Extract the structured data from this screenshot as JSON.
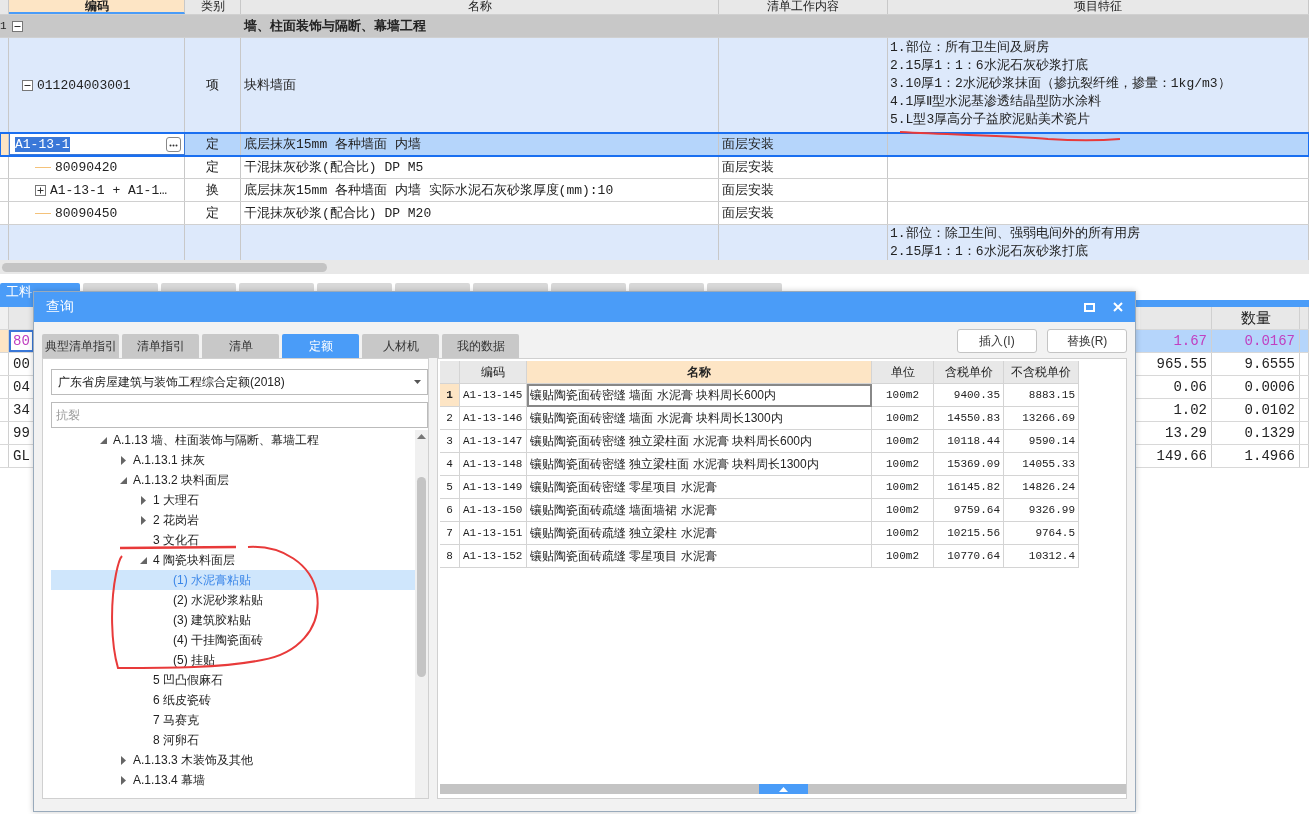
{
  "main_grid": {
    "columns": [
      "编码",
      "类别",
      "名称",
      "清单工作内容",
      "项目特征"
    ],
    "rows": [
      {
        "kind": "section",
        "row_number": "1",
        "expanded": true,
        "name": "墙、柱面装饰与隔断、幕墙工程",
        "selected": false
      },
      {
        "kind": "item",
        "expanded": true,
        "code": "011204003001",
        "type": "项",
        "name": "块料墙面",
        "features": [
          "1.部位：所有卫生间及厨房",
          "2.15厚1：1：6水泥石灰砂浆打底",
          "3.10厚1：2水泥砂浆抹面（掺抗裂纤维，掺量：1kg/m3）",
          "4.1厚Ⅱ型水泥基渗透结晶型防水涂料",
          "5.L型3厚高分子益胶泥贴美术瓷片"
        ],
        "selected": false
      },
      {
        "kind": "quota",
        "code": "A1-13-1",
        "type": "定",
        "name": "底层抹灰15mm 各种墙面 内墙",
        "work": "面层安装",
        "selected": true
      },
      {
        "kind": "material",
        "code": "80090420",
        "type": "定",
        "name": "干混抹灰砂浆(配合比) DP M5",
        "work": "面层安装",
        "selected": false
      },
      {
        "kind": "material",
        "expanded": false,
        "code": "A1-13-1 + A1-1…",
        "type": "换",
        "name": "底层抹灰15mm 各种墙面 内墙  实际水泥石灰砂浆厚度(mm):10",
        "work": "面层安装",
        "selected": false
      },
      {
        "kind": "material",
        "code": "80090450",
        "type": "定",
        "name": "干混抹灰砂浆(配合比) DP M20",
        "work": "面层安装",
        "selected": false
      },
      {
        "kind": "item-cut",
        "features": [
          "1.部位：除卫生间、强弱电间外的所有用房",
          "2.15厚1：1：6水泥石灰砂浆打底"
        ],
        "selected": false
      }
    ]
  },
  "bottom_tabs": [
    {
      "label": "工料",
      "selected": true
    },
    {
      "selected": false
    },
    {
      "selected": false
    },
    {
      "selected": false
    },
    {
      "selected": false
    },
    {
      "selected": false
    },
    {
      "selected": false
    },
    {
      "selected": false
    },
    {
      "selected": false
    },
    {
      "selected": false
    }
  ],
  "lower_grid": {
    "quantity_column": "数量",
    "rows": [
      {
        "code": "80",
        "price": "1.67",
        "quantity": "0.0167",
        "selected": true
      },
      {
        "code": "00",
        "price": "965.55",
        "quantity": "9.6555",
        "selected": false
      },
      {
        "code": "04",
        "price": "0.06",
        "quantity": "0.0006",
        "selected": false
      },
      {
        "code": "34",
        "price": "1.02",
        "quantity": "0.0102",
        "selected": false
      },
      {
        "code": "99",
        "price": "13.29",
        "quantity": "0.1329",
        "selected": false
      },
      {
        "code": "GL",
        "price": "149.66",
        "quantity": "1.4966",
        "selected": false
      }
    ]
  },
  "dialog": {
    "title": "查询",
    "tabs": [
      {
        "label": "典型清单指引",
        "selected": false
      },
      {
        "label": "清单指引",
        "selected": false
      },
      {
        "label": "清单",
        "selected": false
      },
      {
        "label": "定额",
        "selected": true
      },
      {
        "label": "人材机",
        "selected": false
      },
      {
        "label": "我的数据",
        "selected": false
      }
    ],
    "buttons": [
      "插入(I)",
      "替换(R)"
    ],
    "library": "广东省房屋建筑与装饰工程综合定额(2018)",
    "search": {
      "placeholder": "抗裂"
    },
    "tree": [
      {
        "label": "A.1.13 墙、柱面装饰与隔断、幕墙工程",
        "expanded": true,
        "selected": false,
        "children": [
          {
            "label": "A.1.13.1 抹灰",
            "expanded": false,
            "selected": false
          },
          {
            "label": "A.1.13.2 块料面层",
            "expanded": true,
            "selected": false,
            "children": [
              {
                "label": "1 大理石",
                "expanded": false,
                "selected": false
              },
              {
                "label": "2 花岗岩",
                "expanded": false,
                "selected": false
              },
              {
                "label": "3 文化石",
                "kind": "leaf",
                "selected": false
              },
              {
                "label": "4 陶瓷块料面层",
                "expanded": true,
                "selected": false,
                "children": [
                  {
                    "label": "(1) 水泥膏粘贴",
                    "kind": "leaf",
                    "selected": true
                  },
                  {
                    "label": "(2) 水泥砂浆粘贴",
                    "kind": "leaf",
                    "selected": false
                  },
                  {
                    "label": "(3) 建筑胶粘贴",
                    "kind": "leaf",
                    "selected": false
                  },
                  {
                    "label": "(4) 干挂陶瓷面砖",
                    "kind": "leaf",
                    "selected": false
                  },
                  {
                    "label": "(5) 挂贴",
                    "kind": "leaf",
                    "selected": false
                  }
                ]
              },
              {
                "label": "5 凹凸假麻石",
                "kind": "leaf",
                "selected": false
              },
              {
                "label": "6 纸皮瓷砖",
                "kind": "leaf",
                "selected": false
              },
              {
                "label": "7 马赛克",
                "kind": "leaf",
                "selected": false
              },
              {
                "label": "8 河卵石",
                "kind": "leaf",
                "selected": false
              }
            ]
          },
          {
            "label": "A.1.13.3 木装饰及其他",
            "expanded": false,
            "selected": false
          },
          {
            "label": "A.1.13.4 幕墙",
            "expanded": false,
            "selected": false
          }
        ]
      }
    ],
    "results": {
      "columns": [
        "编码",
        "名称",
        "单位",
        "含税单价",
        "不含税单价"
      ],
      "rows": [
        {
          "number": "1",
          "code": "A1-13-145",
          "name": "镶贴陶瓷面砖密缝 墙面 水泥膏 块料周长600内",
          "unit": "100m2",
          "price_tax": "9400.35",
          "price": "8883.15",
          "selected": true
        },
        {
          "number": "2",
          "code": "A1-13-146",
          "name": "镶贴陶瓷面砖密缝 墙面 水泥膏 块料周长1300内",
          "unit": "100m2",
          "price_tax": "14550.83",
          "price": "13266.69",
          "selected": false
        },
        {
          "number": "3",
          "code": "A1-13-147",
          "name": "镶贴陶瓷面砖密缝 独立梁柱面 水泥膏 块料周长600内",
          "unit": "100m2",
          "price_tax": "10118.44",
          "price": "9590.14",
          "selected": false
        },
        {
          "number": "4",
          "code": "A1-13-148",
          "name": "镶贴陶瓷面砖密缝 独立梁柱面 水泥膏 块料周长1300内",
          "unit": "100m2",
          "price_tax": "15369.09",
          "price": "14055.33",
          "selected": false
        },
        {
          "number": "5",
          "code": "A1-13-149",
          "name": "镶贴陶瓷面砖密缝 零星项目 水泥膏",
          "unit": "100m2",
          "price_tax": "16145.82",
          "price": "14826.24",
          "selected": false
        },
        {
          "number": "6",
          "code": "A1-13-150",
          "name": "镶贴陶瓷面砖疏缝 墙面墙裙 水泥膏",
          "unit": "100m2",
          "price_tax": "9759.64",
          "price": "9326.99",
          "selected": false
        },
        {
          "number": "7",
          "code": "A1-13-151",
          "name": "镶贴陶瓷面砖疏缝 独立梁柱 水泥膏",
          "unit": "100m2",
          "price_tax": "10215.56",
          "price": "9764.5",
          "selected": false
        },
        {
          "number": "8",
          "code": "A1-13-152",
          "name": "镶贴陶瓷面砖疏缝 零星项目 水泥膏",
          "unit": "100m2",
          "price_tax": "10770.64",
          "price": "10312.4",
          "selected": false
        }
      ]
    }
  }
}
